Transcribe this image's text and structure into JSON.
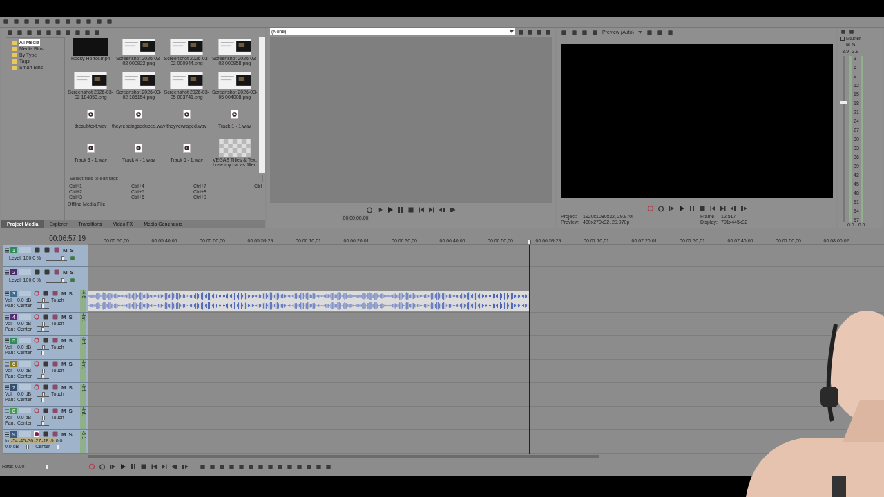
{
  "media_tree": [
    {
      "label": "All Media",
      "selected": true
    },
    {
      "label": "Media Bins",
      "selected": false
    },
    {
      "label": "By Type",
      "selected": false
    },
    {
      "label": "Tags",
      "selected": false
    },
    {
      "label": "Smart Bins",
      "selected": false
    }
  ],
  "media_items": [
    {
      "kind": "video",
      "name": "Rocky Horror.mp4"
    },
    {
      "name": "Screenshot 2026-03-02 000922.png"
    },
    {
      "name": "Screenshot 2026-03-02 000944.png"
    },
    {
      "name": "Screenshot 2026-03-02 000958.png"
    },
    {
      "name": "Screenshot 2026-03-02 184858.png"
    },
    {
      "name": "Screenshot 2026-03-02 185154.png"
    },
    {
      "name": "Screenshot 2026-03-05 003741.png"
    },
    {
      "name": "Screenshot 2026-03-05 004008.png"
    },
    {
      "kind": "audio",
      "name": "thesubtext.wav"
    },
    {
      "kind": "audio",
      "name": "theyrebeingseduced.wav"
    },
    {
      "kind": "audio",
      "name": "theyvewraped.wav"
    },
    {
      "kind": "audio",
      "name": "Track 1 - 1.wav"
    },
    {
      "kind": "audio",
      "name": "Track 3 - 1.wav"
    },
    {
      "kind": "audio",
      "name": "Track 4 - 1.wav"
    },
    {
      "kind": "audio",
      "name": "Track 6 - 1.wav"
    },
    {
      "kind": "title",
      "name": "VEGAS Titles & Text I use my cat as filler."
    }
  ],
  "tag_filter": {
    "placeholder": "Select files to edit tags"
  },
  "tag_shortcuts": [
    "Ctrl+1",
    "Ctrl+4",
    "Ctrl+7",
    "Ctrl",
    "Ctrl+2",
    "Ctrl+5",
    "Ctrl+8",
    "Ctrl+3",
    "Ctrl+6",
    "Ctrl+9"
  ],
  "media_status": "Offline Media File",
  "dock_tabs": [
    {
      "label": "Project Media",
      "selected": true
    },
    {
      "label": "Explorer",
      "selected": false
    },
    {
      "label": "Transitions",
      "selected": false
    },
    {
      "label": "Video FX",
      "selected": false
    },
    {
      "label": "Media Generators",
      "selected": false
    }
  ],
  "trimmer": {
    "source": "(None)",
    "time": "00:00:00;00"
  },
  "preview": {
    "quality": "Preview (Auto)",
    "info": [
      {
        "label": "Project:",
        "value": "1920x1080x32, 29.970i"
      },
      {
        "label": "Frame:",
        "value": "12,517"
      },
      {
        "label": "Preview:",
        "value": "480x270x32, 29.970p"
      },
      {
        "label": "Display:",
        "value": "791x445x32"
      }
    ]
  },
  "master": {
    "title": "Master",
    "mute": "M",
    "solo": "S",
    "peaks": [
      "-3.9",
      "-3.9"
    ],
    "scale": [
      "3",
      "6",
      "9",
      "12",
      "15",
      "18",
      "21",
      "24",
      "27",
      "30",
      "33",
      "36",
      "39",
      "42",
      "45",
      "48",
      "51",
      "54",
      "57"
    ],
    "levels": [
      "0.6",
      "0.6"
    ],
    "level": 0.72
  },
  "timeline": {
    "time": "00:06:57;19",
    "ruler": [
      "00:05:30;00",
      "00:05:40;00",
      "00:05:50;00",
      "00:05:59;29",
      "00:06:10;01",
      "00:06:20;01",
      "00:06:30;00",
      "00:06:40;00",
      "00:06:50;00",
      "00:06:59;29",
      "00:07:10;01",
      "00:07:20;01",
      "00:07:30;01",
      "00:07:40;00",
      "00:07:50;00",
      "00:08:00;02"
    ]
  },
  "tracks": [
    {
      "kind": "video",
      "number": "1",
      "color": "#2e8b57",
      "mute": "M",
      "solo": "S",
      "level_text": "Level: 100.0 %",
      "level": 0.85
    },
    {
      "kind": "video",
      "number": "2",
      "color": "#4b2a6e",
      "mute": "M",
      "solo": "S",
      "level_text": "Level: 100.0 %",
      "level": 0.85
    },
    {
      "kind": "audio",
      "number": "3",
      "color": "#3d6b8f",
      "mute": "M",
      "solo": "S",
      "vol_label": "Vol:",
      "vol": "0.0 dB",
      "vol_slider": {
        "level": 0.6
      },
      "pan_label": "Pan:",
      "pan": "Center",
      "pan_slider": {
        "level": 0.5
      },
      "mode": "Touch",
      "peak": "-4.6",
      "armed": false,
      "clips": [
        {
          "kind": "audio"
        }
      ]
    },
    {
      "kind": "audio",
      "number": "4",
      "color": "#5a2a78",
      "mute": "M",
      "solo": "S",
      "vol_label": "Vol:",
      "vol": "0.0 dB",
      "vol_slider": {
        "level": 0.6
      },
      "pan_label": "Pan:",
      "pan": "Center",
      "pan_slider": {
        "level": 0.5
      },
      "mode": "Touch",
      "peak": "-Inf.",
      "armed": false
    },
    {
      "kind": "audio",
      "number": "5",
      "color": "#2e8b57",
      "mute": "M",
      "solo": "S",
      "vol_label": "Vol:",
      "vol": "0.0 dB",
      "vol_slider": {
        "level": 0.6
      },
      "pan_label": "Pan:",
      "pan": "Center",
      "pan_slider": {
        "level": 0.5
      },
      "mode": "Touch",
      "peak": "-Inf.",
      "armed": false
    },
    {
      "kind": "audio",
      "number": "6",
      "color": "#8a7a20",
      "mute": "M",
      "solo": "S",
      "vol_label": "Vol:",
      "vol": "0.0 dB",
      "vol_slider": {
        "level": 0.6
      },
      "pan_label": "Pan:",
      "pan": "Center",
      "pan_slider": {
        "level": 0.5
      },
      "mode": "Touch",
      "peak": "-Inf.",
      "armed": false
    },
    {
      "kind": "audio",
      "number": "7",
      "color": "#34506e",
      "mute": "M",
      "solo": "S",
      "vol_label": "Vol:",
      "vol": "0.0 dB",
      "vol_slider": {
        "level": 0.6
      },
      "pan_label": "Pan:",
      "pan": "Center",
      "pan_slider": {
        "level": 0.5
      },
      "mode": "Touch",
      "peak": "-Inf.",
      "armed": false
    },
    {
      "kind": "audio",
      "number": "8",
      "color": "#3f9a4f",
      "mute": "M",
      "solo": "S",
      "vol_label": "Vol:",
      "vol": "0.0 dB",
      "vol_slider": {
        "level": 0.6
      },
      "pan_label": "Pan:",
      "pan": "Center",
      "pan_slider": {
        "level": 0.5
      },
      "mode": "Touch",
      "peak": "-Inf.",
      "armed": false
    },
    {
      "kind": "input",
      "number": "9",
      "color": "#3d5a80",
      "mute": "M",
      "solo": "S",
      "in_label": "In",
      "meter": [
        "-54",
        "-45",
        "-36",
        "-27",
        "-18",
        "-9"
      ],
      "meter_end": "0.0",
      "vol": "0.0 dB",
      "vol_slider": {
        "level": 0.6
      },
      "pan": "Center",
      "pan_slider": {
        "level": 0.5
      },
      "peak": "-6.1",
      "armed": true
    }
  ],
  "rate": "Rate: 0.00",
  "rate_slider": {
    "level": 0.5
  }
}
